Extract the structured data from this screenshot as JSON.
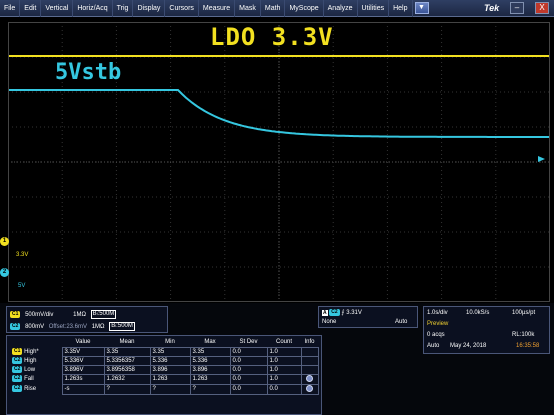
{
  "menu": {
    "items": [
      "File",
      "Edit",
      "Vertical",
      "Horiz/Acq",
      "Trig",
      "Display",
      "Cursors",
      "Measure",
      "Mask",
      "Math",
      "MyScope",
      "Analyze",
      "Utilities",
      "Help"
    ],
    "dropdown_glyph": "▼",
    "brand": "Tek",
    "minimize_glyph": "–",
    "close_glyph": "X"
  },
  "traces": {
    "ldo_label": "LDO 3.3V",
    "vstb_label": "5Vstb",
    "ldo_color": "#f2e020",
    "vstb_color": "#35c7e0"
  },
  "markers": {
    "ch1_number": "1",
    "ch2_number": "2",
    "ch1_label": "3.3V",
    "ch2_label": "5V"
  },
  "channels": [
    {
      "badge": "C1",
      "scale": "500mV/div",
      "offset": "",
      "impedance": "1MΩ",
      "bandwidth": "Bₗ:500M"
    },
    {
      "badge": "C2",
      "scale": "800mV",
      "offset": "Offset:23.6mV",
      "impedance": "1MΩ",
      "bandwidth": "Bₗ:500M"
    }
  ],
  "trigger": {
    "mode_badge": "A",
    "source_badge": "C2",
    "edge_glyph": "⨍",
    "level": "3.31V",
    "coupling": "None",
    "sweep": "Auto"
  },
  "acquisition": {
    "time_div": "1.0s/div",
    "sample_rate": "10.0kS/s",
    "resolution": "100µs/pt",
    "status": "Preview",
    "acqs": "0 acqs",
    "record_length": "RL:100k",
    "mode": "Auto",
    "date": "May 24, 2018",
    "time": "16:35:58"
  },
  "measurements": {
    "headers": [
      "",
      "Value",
      "Mean",
      "Min",
      "Max",
      "St Dev",
      "Count",
      "Info"
    ],
    "rows": [
      {
        "badge": "C1",
        "name": "High*",
        "value": "3.35V",
        "mean": "3.35",
        "min": "3.35",
        "max": "3.35",
        "stdev": "0.0",
        "count": "1.0",
        "info": false
      },
      {
        "badge": "C2",
        "name": "High",
        "value": "5.336V",
        "mean": "5.3356357",
        "min": "5.336",
        "max": "5.336",
        "stdev": "0.0",
        "count": "1.0",
        "info": false
      },
      {
        "badge": "C2",
        "name": "Low",
        "value": "3.896V",
        "mean": "3.8956358",
        "min": "3.896",
        "max": "3.896",
        "stdev": "0.0",
        "count": "1.0",
        "info": false
      },
      {
        "badge": "C2",
        "name": "Fall",
        "value": "1.263s",
        "mean": "1.2632",
        "min": "1.263",
        "max": "1.263",
        "stdev": "0.0",
        "count": "1.0",
        "info": true
      },
      {
        "badge": "C2",
        "name": "Rise",
        "value": "-s",
        "mean": "?",
        "min": "?",
        "max": "?",
        "stdev": "0.0",
        "count": "0.0",
        "info": true
      }
    ]
  }
}
